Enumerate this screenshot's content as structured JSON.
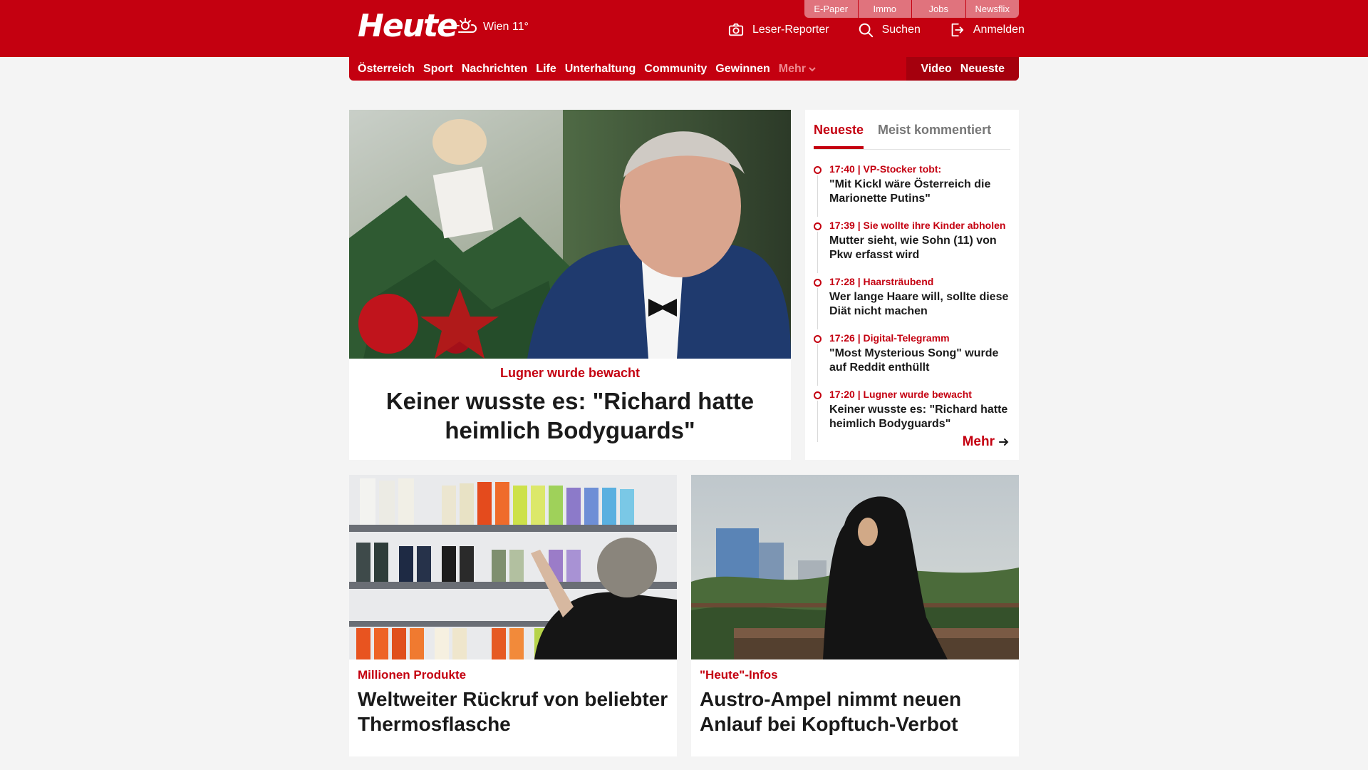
{
  "header": {
    "logo": "Heute",
    "weather": "Wien 11°",
    "service_links": [
      "E-Paper",
      "Immo",
      "Jobs",
      "Newsflix"
    ],
    "actions": {
      "reporter": "Leser-Reporter",
      "search": "Suchen",
      "login": "Anmelden"
    }
  },
  "nav": {
    "items": [
      "Österreich",
      "Sport",
      "Nachrichten",
      "Life",
      "Unterhaltung",
      "Community",
      "Gewinnen"
    ],
    "more": "Mehr",
    "right": [
      "Video",
      "Neueste"
    ]
  },
  "hero": {
    "kicker": "Lugner wurde bewacht",
    "title": "Keiner wusste es: \"Richard hatte heimlich Bodyguards\""
  },
  "sidebar": {
    "tabs": [
      "Neueste",
      "Meist kommentiert"
    ],
    "active_tab": "Neueste",
    "items": [
      {
        "meta": "17:40 | VP-Stocker tobt:",
        "title": "\"Mit Kickl wäre Österreich die Marionette Putins\""
      },
      {
        "meta": "17:39 | Sie wollte ihre Kinder abholen",
        "title": "Mutter sieht, wie Sohn (11) von Pkw erfasst wird"
      },
      {
        "meta": "17:28 | Haarsträubend",
        "title": "Wer lange Haare will, sollte diese Diät nicht machen"
      },
      {
        "meta": "17:26 | Digital-Telegramm",
        "title": "\"Most Mysterious Song\" wurde auf Reddit enthüllt"
      },
      {
        "meta": "17:20 | Lugner wurde bewacht",
        "title": "Keiner wusste es: \"Richard hatte heimlich Bodyguards\""
      }
    ],
    "more": "Mehr"
  },
  "cards": [
    {
      "kicker": "Millionen Produkte",
      "title": "Weltweiter Rückruf von beliebter Thermosflasche"
    },
    {
      "kicker": "\"Heute\"-Infos",
      "title": "Austro-Ampel nimmt neuen Anlauf bei Kopftuch-Verbot"
    }
  ],
  "colors": {
    "brand": "#c40010",
    "brand_dark": "#a5000d",
    "page_bg": "#f4f4f4"
  }
}
